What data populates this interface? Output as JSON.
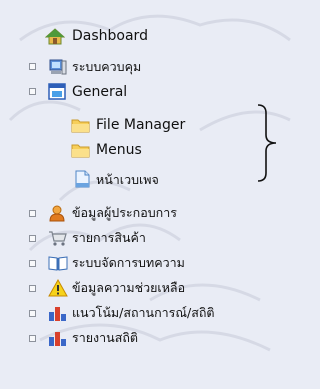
{
  "menu": {
    "dashboard": {
      "label": "Dashboard",
      "icon": "home-icon"
    },
    "control_system": {
      "label": "ระบบควบคุม",
      "icon": "computer-icon"
    },
    "general": {
      "label": "General",
      "icon": "monitor-frame-icon",
      "children": [
        {
          "label": "File Manager",
          "icon": "folder-icon"
        },
        {
          "label": "Menus",
          "icon": "folder-icon"
        },
        {
          "label": "หน้าเวบเพจ",
          "icon": "page-icon"
        }
      ]
    },
    "operators": {
      "label": "ข้อมูลผู้ประกอบการ",
      "icon": "user-icon"
    },
    "products": {
      "label": "รายการสินค้า",
      "icon": "cart-icon"
    },
    "articles": {
      "label": "ระบบจัดการบทความ",
      "icon": "book-icon"
    },
    "help": {
      "label": "ข้อมูลความช่วยเหลือ",
      "icon": "warning-icon"
    },
    "trends": {
      "label": "แนวโน้ม/สถานการณ์/สถิติ",
      "icon": "bar-chart-icon"
    },
    "reports": {
      "label": "รายงานสถิติ",
      "icon": "bar-chart-icon"
    }
  },
  "colors": {
    "background": "#e9ecf5",
    "folder": "#f7cf5a",
    "chart_blue": "#3a67c8",
    "chart_red": "#d9402c"
  }
}
